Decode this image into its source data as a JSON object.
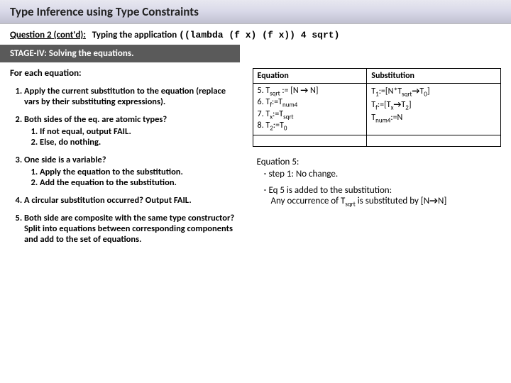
{
  "title": "Type Inference using Type Constraints",
  "question": {
    "lead": "Question 2 (cont'd):",
    "desc": "Typing the application",
    "code": "((lambda (f x)  (f x)) 4 sqrt)"
  },
  "stage": "STAGE-IV: Solving the equations.",
  "foreach": "For each equation:",
  "rules": [
    {
      "text": "Apply the current substitution to the equation (replace vars by their substituting expressions)."
    },
    {
      "text": "Both sides of the eq. are atomic types?",
      "sub": [
        "If not equal, output FAIL.",
        "Else, do nothing."
      ]
    },
    {
      "text": "One side is a variable?",
      "sub": [
        "Apply the equation to the substitution.",
        "Add the equation to the substitution."
      ]
    },
    {
      "text": "A circular substitution occurred? Output FAIL."
    },
    {
      "text": "Both side are composite with the same type constructor? Split into equations between corresponding components and add to the set of equations."
    }
  ],
  "table": {
    "head": {
      "eq": "Equation",
      "sub": "Substitution"
    },
    "eqs": [
      "5. T_sqrt := [N → N]",
      "6. T_f:=T_num4",
      "7. T_x:=T_sqrt",
      "8. T_2:=T_0"
    ],
    "subs": [
      "T_1:=[N*T_sqrt→T_0]",
      "T_f:=[T_x→T_2]",
      "T_num4:=N"
    ]
  },
  "notes": {
    "heading": "Equation 5:",
    "items": [
      "step 1: No change.",
      "Eq 5 is added to the substitution: Any occurrence of T_sqrt is substituted by [N→N]"
    ]
  }
}
